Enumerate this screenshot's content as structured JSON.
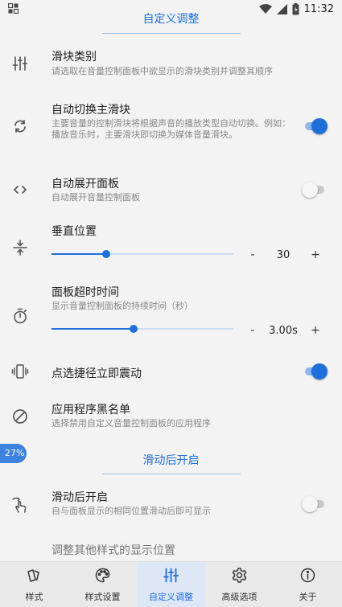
{
  "status_bar": {
    "time": "11:32"
  },
  "sections": {
    "custom_adjust": "自定义调整",
    "scroll_enable": "滑动后开启"
  },
  "items": {
    "slider_types": {
      "title": "滑块类别",
      "subtitle": "请选取在音量控制面板中欲显示的滑块类别并调整其顺序"
    },
    "auto_switch": {
      "title": "自动切换主滑块",
      "subtitle": "主要音量的控制滑块将根据声音的播放类型自动切换。例如：播放音乐时，主要滑块即切换为媒体音量滑块。",
      "enabled": true
    },
    "auto_expand": {
      "title": "自动展开面板",
      "subtitle": "自动展开音量控制面板",
      "enabled": false
    },
    "vertical_pos": {
      "title": "垂直位置",
      "value": "30",
      "minus": "-",
      "plus": "+",
      "level": 0.3
    },
    "panel_timeout": {
      "title": "面板超时时间",
      "subtitle": "显示音量控制面板的持续时间（秒）",
      "value": "3.00s",
      "minus": "-",
      "plus": "+",
      "level": 0.45
    },
    "vibrate": {
      "title": "点选捷径立即震动",
      "enabled": true
    },
    "blacklist": {
      "title": "应用程序黑名单",
      "subtitle": "选择禁用自定义音量控制面板的应用程序"
    },
    "enable_after_scroll": {
      "title": "滑动后开启",
      "subtitle": "自与面板显示的相同位置滑动后即可显示",
      "enabled": false
    },
    "other_styles_pos": {
      "title": "调整其他样式的显示位置"
    }
  },
  "floating_badge": "27%",
  "bottom_nav": [
    {
      "label": "样式",
      "icon": "style-icon",
      "active": false
    },
    {
      "label": "样式设置",
      "icon": "palette-icon",
      "active": false
    },
    {
      "label": "自定义调整",
      "icon": "tune-icon",
      "active": true
    },
    {
      "label": "高级选项",
      "icon": "gear-icon",
      "active": false
    },
    {
      "label": "关于",
      "icon": "info-icon",
      "active": false
    }
  ],
  "colors": {
    "accent": "#1e6fd9",
    "background": "#f3f3f3",
    "nav_background": "#e9e9e9"
  }
}
